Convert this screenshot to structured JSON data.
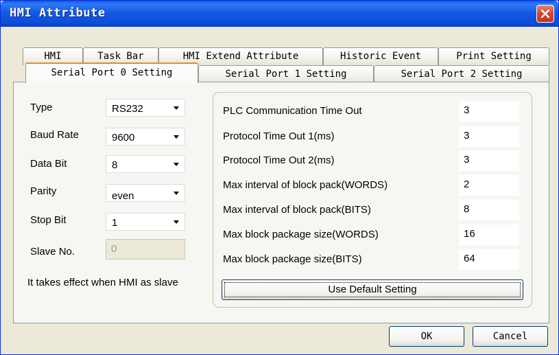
{
  "window": {
    "title": "HMI Attribute"
  },
  "tabs_row1": [
    {
      "label": "HMI"
    },
    {
      "label": "Task Bar"
    },
    {
      "label": "HMI Extend Attribute"
    },
    {
      "label": "Historic Event"
    },
    {
      "label": "Print Setting"
    }
  ],
  "tabs_row2": [
    {
      "label": "Serial Port 0 Setting",
      "active": true
    },
    {
      "label": "Serial Port 1 Setting"
    },
    {
      "label": "Serial Port 2 Setting"
    }
  ],
  "serial": {
    "type": {
      "label": "Type",
      "value": "RS232"
    },
    "baud_rate": {
      "label": "Baud Rate",
      "value": "9600"
    },
    "data_bit": {
      "label": "Data Bit",
      "value": "8"
    },
    "parity": {
      "label": "Parity",
      "value": "even"
    },
    "stop_bit": {
      "label": "Stop Bit",
      "value": "1"
    },
    "slave_no": {
      "label": "Slave No.",
      "value": "0"
    },
    "note": "It takes effect when HMI as slave"
  },
  "settings": [
    {
      "label": "PLC Communication Time Out",
      "value": "3"
    },
    {
      "label": "Protocol Time Out 1(ms)",
      "value": "3"
    },
    {
      "label": "Protocol Time Out 2(ms)",
      "value": "3"
    },
    {
      "label": "Max interval of block pack(WORDS)",
      "value": "2"
    },
    {
      "label": "Max interval of block pack(BITS)",
      "value": "8"
    },
    {
      "label": "Max block package size(WORDS)",
      "value": "16"
    },
    {
      "label": "Max block package size(BITS)",
      "value": "64"
    }
  ],
  "default_button": "Use Default Setting",
  "ok_button": "OK",
  "cancel_button": "Cancel"
}
